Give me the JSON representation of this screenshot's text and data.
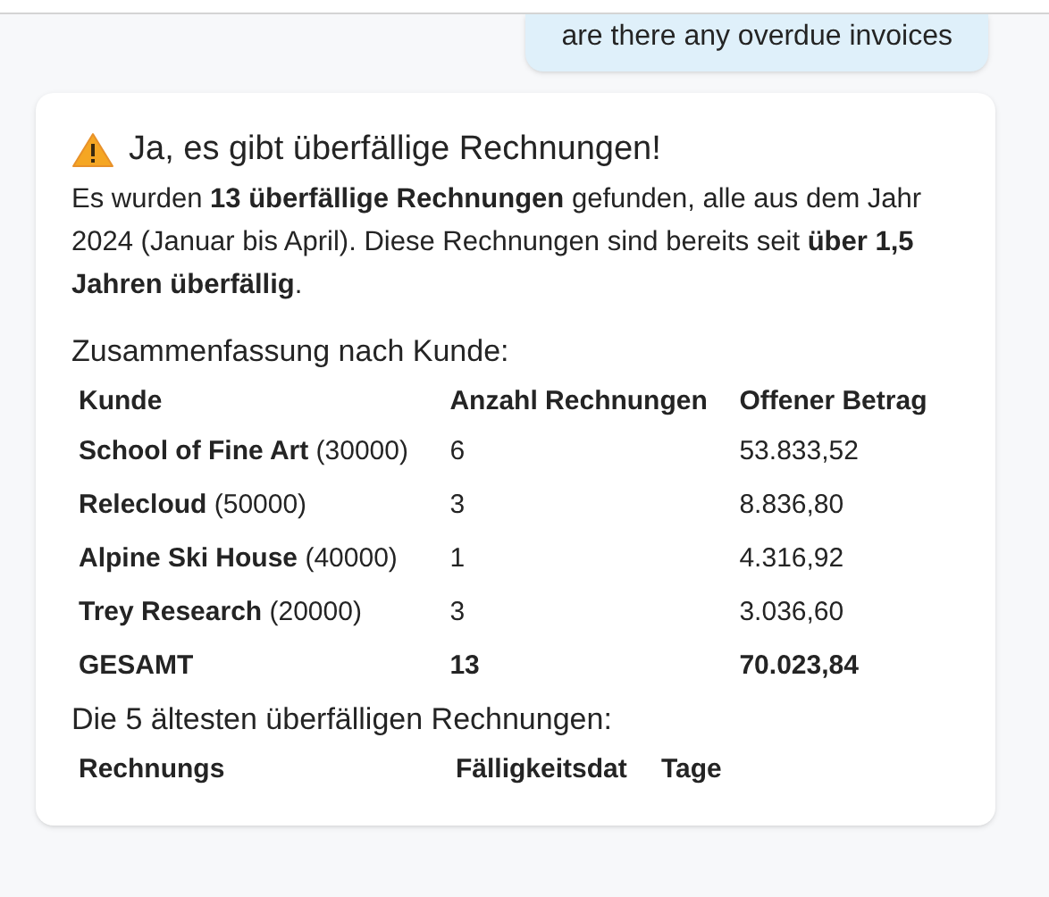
{
  "user_message": "are there any overdue invoices",
  "answer": {
    "title": "Ja, es gibt überfällige Rechnungen!",
    "intro": "Es wurden **13 überfällige Rechnungen** gefunden, alle aus dem Jahr 2024 (Januar bis April). Diese Rechnungen sind bereits seit **über 1,5 Jahren überfällig**.",
    "summary_heading": "Zusammenfassung nach Kunde:",
    "summary_table": {
      "columns": [
        "Kunde",
        "Anzahl Rechnungen",
        "Offener Betrag"
      ],
      "rows": [
        {
          "kind": "customer",
          "cells": [
            "**School of Fine Art** (30000)",
            "6",
            "53.833,52"
          ]
        },
        {
          "kind": "customer",
          "cells": [
            "**Relecloud** (50000)",
            "3",
            "8.836,80"
          ]
        },
        {
          "kind": "customer",
          "cells": [
            "**Alpine Ski House** (40000)",
            "1",
            "4.316,92"
          ]
        },
        {
          "kind": "customer",
          "cells": [
            "**Trey Research** (20000)",
            "3",
            "3.036,60"
          ]
        },
        {
          "kind": "total",
          "cells": [
            "GESAMT",
            "13",
            "70.023,84"
          ]
        }
      ]
    },
    "oldest_heading": "Die 5 ältesten überfälligen Rechnungen:",
    "oldest_table": {
      "columns": [
        "Rechnungs",
        "Fälligkeitsdat",
        "Tage"
      ]
    }
  }
}
